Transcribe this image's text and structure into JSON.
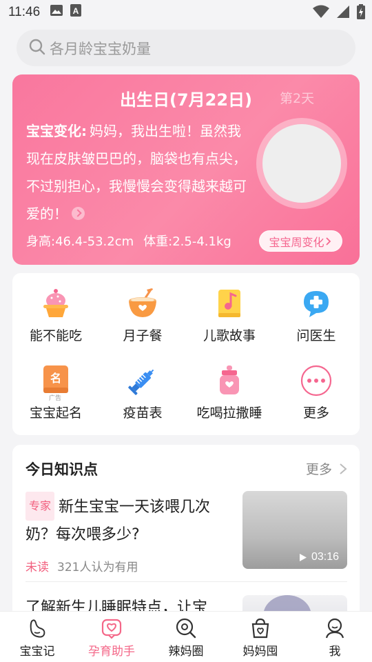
{
  "status_bar": {
    "time": "11:46",
    "icons": [
      "image-icon",
      "text-a-icon",
      "wifi-icon",
      "signal-icon",
      "battery-icon"
    ]
  },
  "search": {
    "placeholder": "各月龄宝宝奶量"
  },
  "hero": {
    "title": "出生日(7月22日)",
    "day": "第2天",
    "label": "宝宝变化:",
    "text": "妈妈，我出生啦！虽然我现在皮肤皱巴巴的，脑袋也有点尖，不过别担心，我慢慢会变得越来越可爱的！",
    "height": "身高:46.4-53.2cm",
    "weight": "体重:2.5-4.1kg",
    "button": "宝宝周变化",
    "colors": {
      "accent": "#f7779d",
      "button_text": "#f5668f"
    }
  },
  "tools": [
    {
      "label": "能不能吃",
      "icon": "cupcake-icon"
    },
    {
      "label": "月子餐",
      "icon": "bowl-icon"
    },
    {
      "label": "儿歌故事",
      "icon": "music-book-icon"
    },
    {
      "label": "问医生",
      "icon": "medical-chat-icon"
    },
    {
      "label": "宝宝起名",
      "icon": "name-book-icon",
      "badge": "广告"
    },
    {
      "label": "疫苗表",
      "icon": "syringe-icon"
    },
    {
      "label": "吃喝拉撒睡",
      "icon": "baby-bottle-icon"
    },
    {
      "label": "更多",
      "icon": "more-icon"
    }
  ],
  "knowledge": {
    "heading": "今日知识点",
    "more": "更多",
    "articles": [
      {
        "tag": "专家",
        "title": "新生宝宝一天该喂几次奶？每次喂多少?",
        "status": "未读",
        "useful": "321人认为有用",
        "duration": "03:16"
      },
      {
        "title": "了解新生儿睡眠特点，让宝"
      }
    ]
  },
  "tabbar": [
    {
      "label": "宝宝记",
      "icon": "baby-footprint-icon",
      "active": false
    },
    {
      "label": "孕育助手",
      "icon": "heart-chat-icon",
      "active": true
    },
    {
      "label": "辣妈圈",
      "icon": "search-circle-icon",
      "active": false
    },
    {
      "label": "妈妈囤",
      "icon": "shopping-bag-icon",
      "active": false
    },
    {
      "label": "我",
      "icon": "user-icon",
      "active": false
    }
  ]
}
